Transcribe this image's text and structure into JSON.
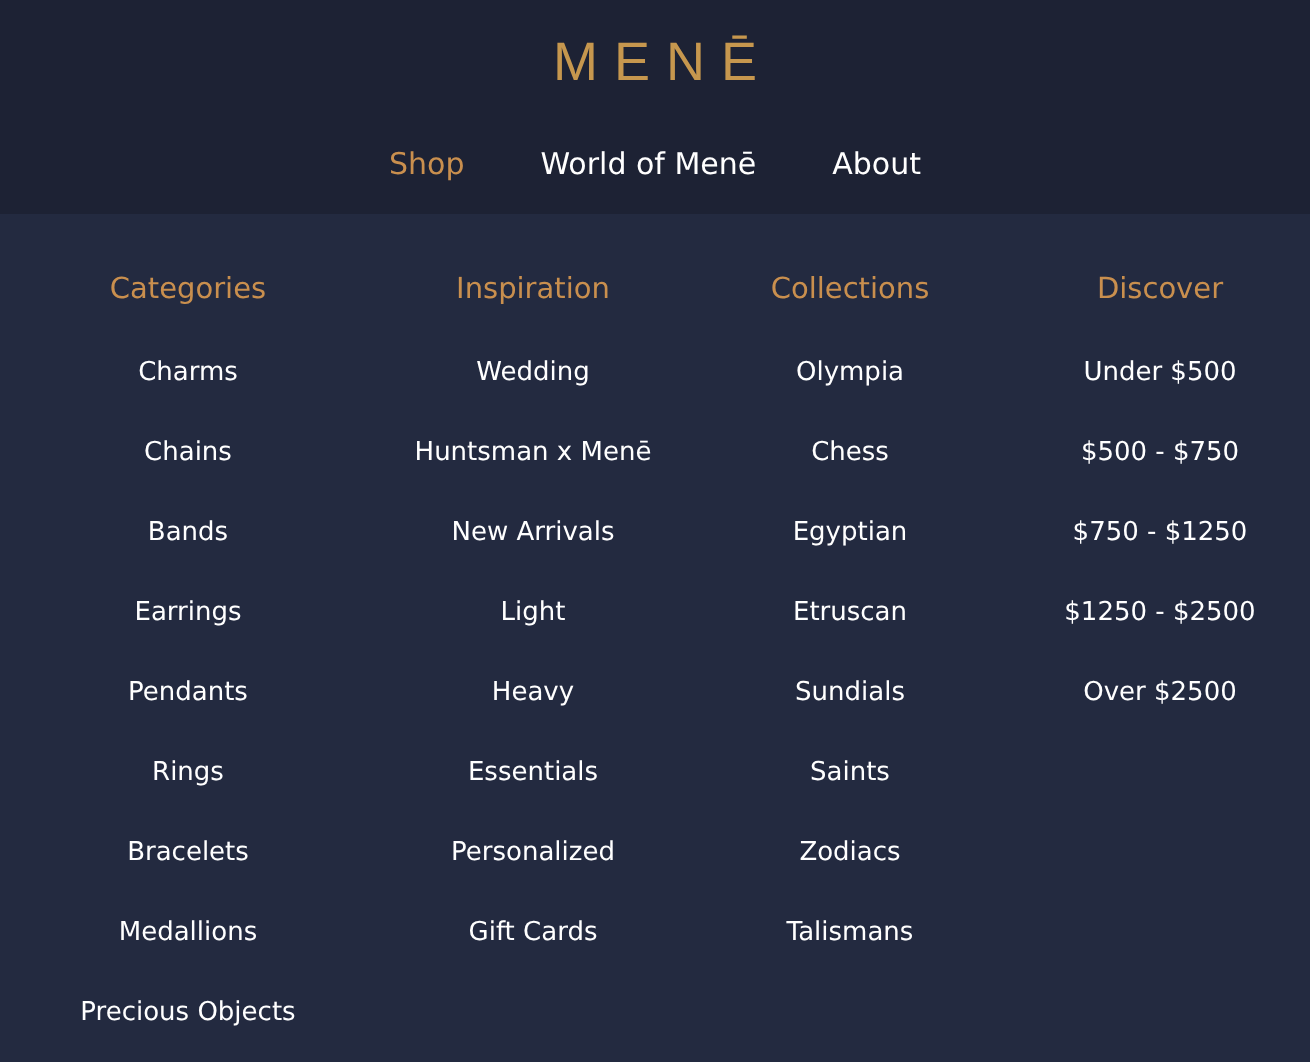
{
  "logo": "MENĒ",
  "nav": [
    {
      "label": "Shop",
      "selected": true
    },
    {
      "label": "World of Menē",
      "selected": false
    },
    {
      "label": "About",
      "selected": false
    }
  ],
  "columns": [
    {
      "heading": "Categories",
      "items": [
        "Charms",
        "Chains",
        "Bands",
        "Earrings",
        "Pendants",
        "Rings",
        "Bracelets",
        "Medallions",
        "Precious Objects"
      ]
    },
    {
      "heading": "Inspiration",
      "items": [
        "Wedding",
        "Huntsman x Menē",
        "New Arrivals",
        "Light",
        "Heavy",
        "Essentials",
        "Personalized",
        "Gift Cards"
      ]
    },
    {
      "heading": "Collections",
      "items": [
        "Olympia",
        "Chess",
        "Egyptian",
        "Etruscan",
        "Sundials",
        "Saints",
        "Zodiacs",
        "Talismans"
      ]
    },
    {
      "heading": "Discover",
      "items": [
        "Under $500",
        "$500 - $750",
        "$750 - $1250",
        "$1250 - $2500",
        "Over $2500"
      ]
    }
  ]
}
